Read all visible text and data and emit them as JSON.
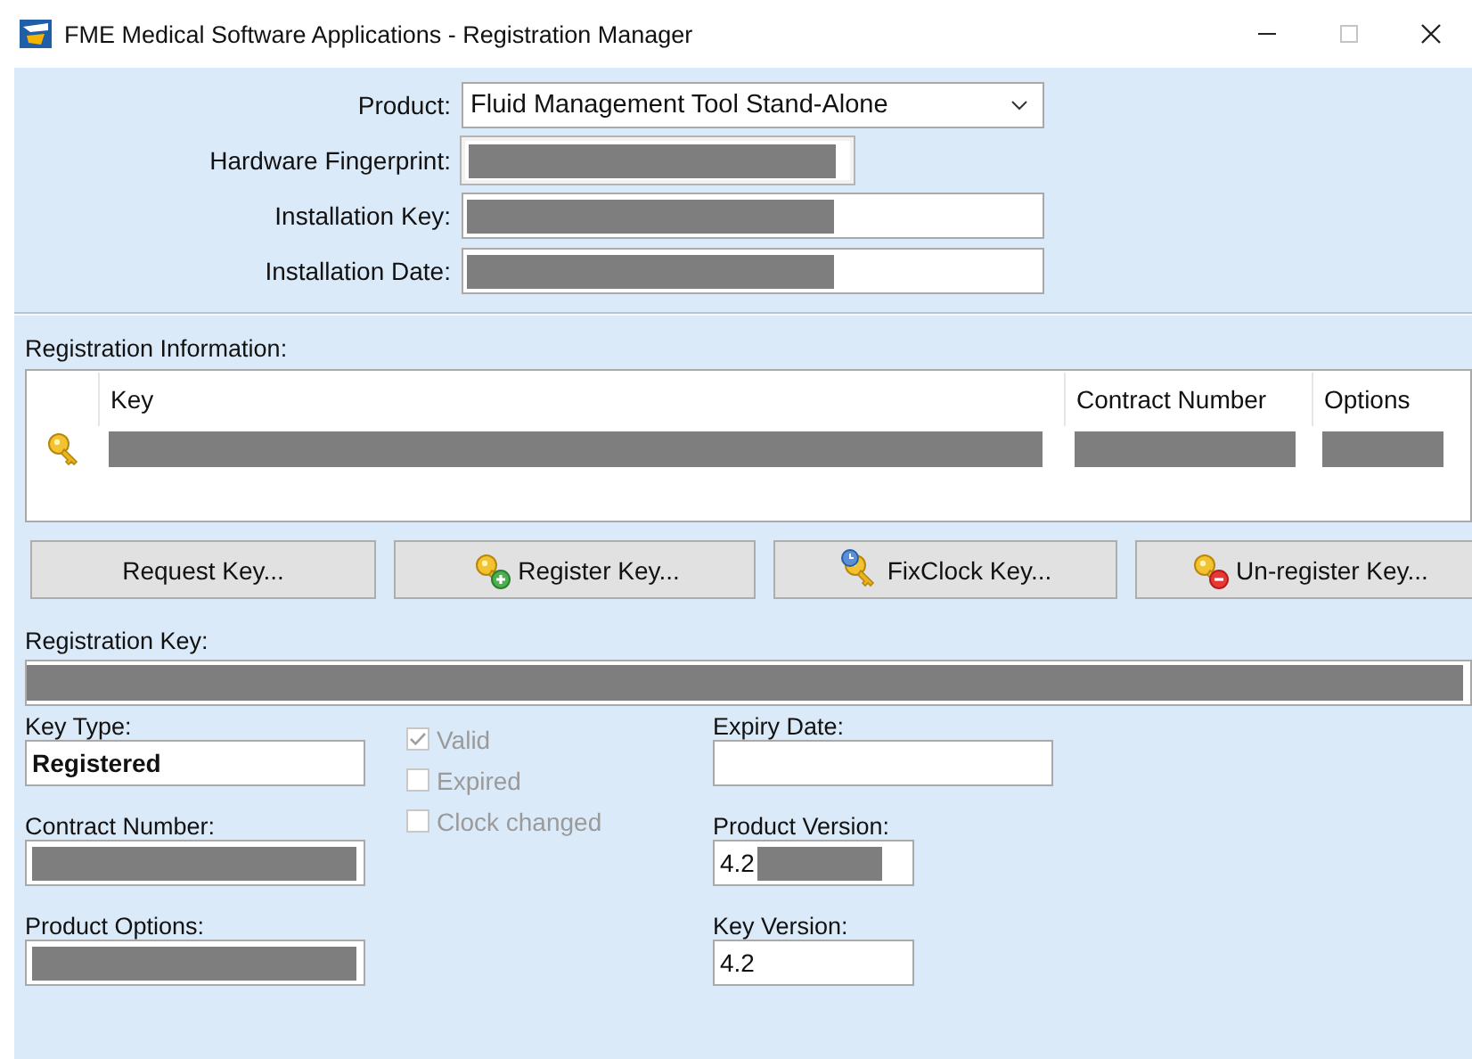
{
  "window": {
    "title": "FME Medical Software Applications - Registration Manager"
  },
  "product_fields": [
    {
      "label": "Product:",
      "kind": "dropdown",
      "value": "Fluid Management Tool Stand-Alone"
    },
    {
      "label": "Hardware Fingerprint:",
      "kind": "display",
      "redacted": true
    },
    {
      "label": "Installation Key:",
      "kind": "text",
      "redacted": true
    },
    {
      "label": "Installation Date:",
      "kind": "text",
      "redacted": true
    }
  ],
  "registration_information": {
    "label": "Registration Information:",
    "columns": [
      "Key",
      "Contract Number",
      "Options"
    ],
    "rows": [
      {
        "redacted": true
      }
    ]
  },
  "buttons": [
    {
      "label": "Request Key...",
      "kind": "plain"
    },
    {
      "label": "Register Key...",
      "kind": "register"
    },
    {
      "label": "FixClock Key...",
      "kind": "fixclock"
    },
    {
      "label": "Un-register Key...",
      "kind": "unregister"
    }
  ],
  "registration_key": {
    "label": "Registration Key:",
    "redacted": true
  },
  "details": {
    "left": [
      {
        "label": "Key Type:",
        "value": "Registered",
        "bold": true
      },
      {
        "label": "Contract Number:",
        "redacted": true
      },
      {
        "label": "Product Options:",
        "redacted": true
      }
    ],
    "checkboxes": [
      {
        "label": "Valid",
        "checked": true,
        "disabled": true
      },
      {
        "label": "Expired",
        "checked": false,
        "disabled": true
      },
      {
        "label": "Clock changed",
        "checked": false,
        "disabled": true
      }
    ],
    "right": [
      {
        "label": "Expiry Date:"
      },
      {
        "label": "Product Version:",
        "value": "4.2",
        "redacted": true
      },
      {
        "label": "Key Version:",
        "value": "4.2"
      }
    ]
  }
}
